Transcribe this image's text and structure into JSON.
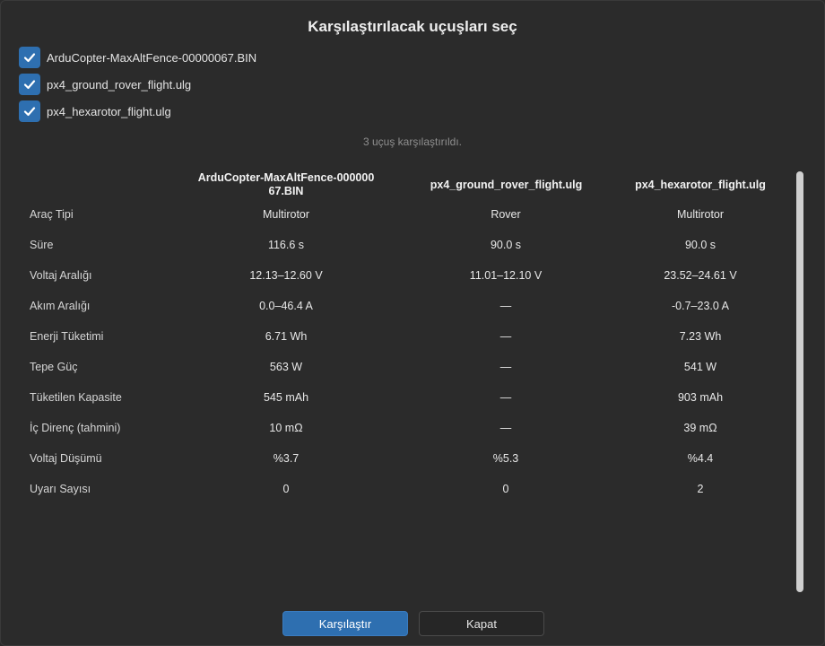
{
  "dialog": {
    "title": "Karşılaştırılacak uçuşları seç",
    "status": "3 uçuş karşılaştırıldı."
  },
  "flights": [
    {
      "label": "ArduCopter-MaxAltFence-00000067.BIN",
      "checked": true
    },
    {
      "label": "px4_ground_rover_flight.ulg",
      "checked": true
    },
    {
      "label": "px4_hexarotor_flight.ulg",
      "checked": true
    }
  ],
  "table": {
    "headers": [
      "ArduCopter-MaxAltFence-000000\n67.BIN",
      "px4_ground_rover_flight.ulg",
      "px4_hexarotor_flight.ulg"
    ],
    "rows": [
      {
        "label": "Araç Tipi",
        "values": [
          "Multirotor",
          "Rover",
          "Multirotor"
        ]
      },
      {
        "label": "Süre",
        "values": [
          "116.6 s",
          "90.0 s",
          "90.0 s"
        ]
      },
      {
        "label": "Voltaj Aralığı",
        "values": [
          "12.13–12.60 V",
          "11.01–12.10 V",
          "23.52–24.61 V"
        ]
      },
      {
        "label": "Akım Aralığı",
        "values": [
          "0.0–46.4 A",
          "—",
          "-0.7–23.0 A"
        ]
      },
      {
        "label": "Enerji Tüketimi",
        "values": [
          "6.71 Wh",
          "—",
          "7.23 Wh"
        ]
      },
      {
        "label": "Tepe Güç",
        "values": [
          "563 W",
          "—",
          "541 W"
        ]
      },
      {
        "label": "Tüketilen Kapasite",
        "values": [
          "545 mAh",
          "—",
          "903 mAh"
        ]
      },
      {
        "label": "İç Direnç (tahmini)",
        "values": [
          "10 mΩ",
          "—",
          "39 mΩ"
        ]
      },
      {
        "label": "Voltaj Düşümü",
        "values": [
          "%3.7",
          "%5.3",
          "%4.4"
        ]
      },
      {
        "label": "Uyarı Sayısı",
        "values": [
          "0",
          "0",
          "2"
        ]
      }
    ]
  },
  "buttons": {
    "compare": "Karşılaştır",
    "close": "Kapat"
  },
  "colors": {
    "background": "#2b2b2b",
    "accent": "#2e6fb0",
    "muted_text": "#8f8f8f"
  },
  "icons": {
    "checkbox": "checkmark-icon"
  }
}
